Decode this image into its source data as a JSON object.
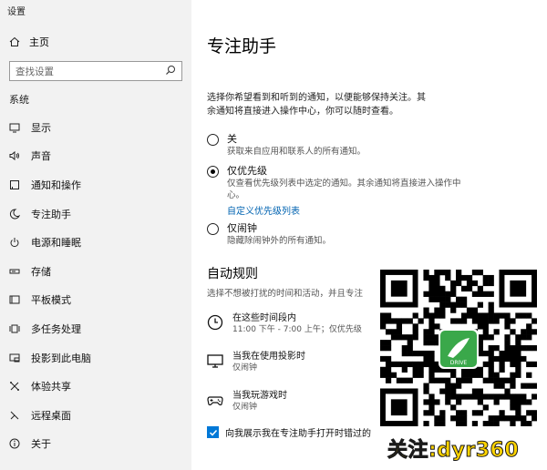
{
  "window": {
    "title": "设置"
  },
  "sidebar": {
    "home_label": "主页",
    "search_placeholder": "查找设置",
    "section_label": "系统",
    "items": [
      {
        "label": "显示",
        "icon": "display-icon"
      },
      {
        "label": "声音",
        "icon": "speaker-icon"
      },
      {
        "label": "通知和操作",
        "icon": "notification-icon"
      },
      {
        "label": "专注助手",
        "icon": "moon-icon"
      },
      {
        "label": "电源和睡眠",
        "icon": "power-icon"
      },
      {
        "label": "存储",
        "icon": "storage-icon"
      },
      {
        "label": "平板模式",
        "icon": "tablet-icon"
      },
      {
        "label": "多任务处理",
        "icon": "multitask-icon"
      },
      {
        "label": "投影到此电脑",
        "icon": "project-icon"
      },
      {
        "label": "体验共享",
        "icon": "share-icon"
      },
      {
        "label": "远程桌面",
        "icon": "remote-icon"
      },
      {
        "label": "关于",
        "icon": "info-icon"
      }
    ]
  },
  "main": {
    "title": "专注助手",
    "description": "选择你希望看到和听到的通知，以便能够保持关注。其余通知将直接进入操作中心，你可以随时查看。",
    "options": [
      {
        "title": "关",
        "desc": "获取来自应用和联系人的所有通知。",
        "checked": false
      },
      {
        "title": "仅优先级",
        "desc": "仅查看优先级列表中选定的通知。其余通知将直接进入操作中心。",
        "checked": true,
        "link": "自定义优先级列表"
      },
      {
        "title": "仅闹钟",
        "desc": "隐藏除闹钟外的所有通知。",
        "checked": false
      }
    ],
    "rules_title": "自动规则",
    "rules_desc": "选择不想被打扰的时间和活动，并且专注",
    "rules": [
      {
        "title": "在这些时间段内",
        "sub": "11:00 下午 - 7:00 上午；仅优先级",
        "icon": "clock-icon"
      },
      {
        "title": "当我在使用投影时",
        "sub": "仅闹钟",
        "icon": "monitor-icon"
      },
      {
        "title": "当我玩游戏时",
        "sub": "仅闹钟",
        "icon": "gamepad-icon"
      }
    ],
    "checkbox_label": "向我展示我在专注助手打开时错过的",
    "checkbox_checked": true
  },
  "overlay": {
    "watermark": "关注:dyr360",
    "qr_logo_text": "DRIVE"
  },
  "colors": {
    "accent": "#0078d7",
    "link": "#0063b1",
    "sidebar_bg": "#f2f2f2",
    "watermark": "#ffd400"
  }
}
